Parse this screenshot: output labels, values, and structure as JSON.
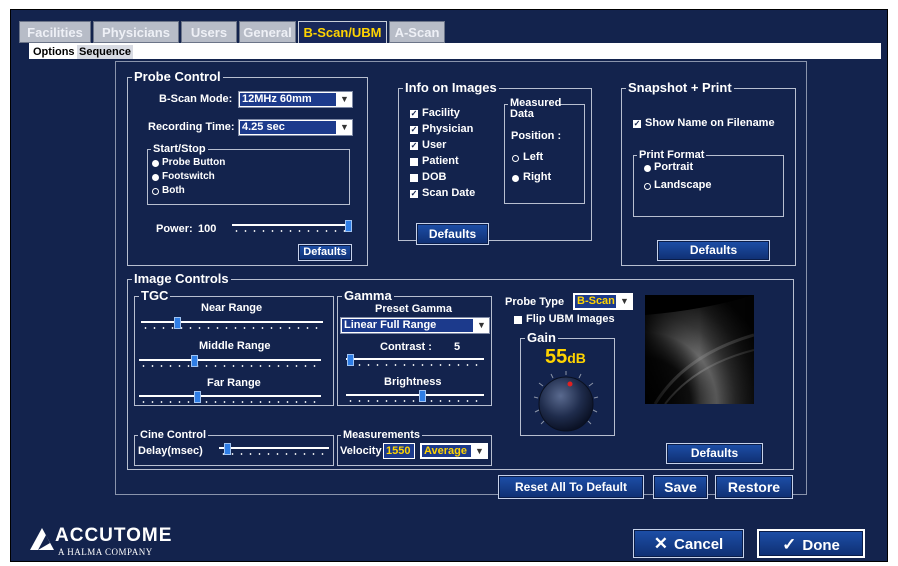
{
  "tabs": [
    {
      "label": "Facilities",
      "active": false
    },
    {
      "label": "Physicians",
      "active": false
    },
    {
      "label": "Users",
      "active": false
    },
    {
      "label": "General",
      "active": false
    },
    {
      "label": "B-Scan/UBM",
      "active": true
    },
    {
      "label": "A-Scan",
      "active": false
    }
  ],
  "subtabs": [
    {
      "label": "Options",
      "selected": true
    },
    {
      "label": "Sequence",
      "selected": false
    }
  ],
  "probe_control": {
    "title": "Probe Control",
    "bscan_mode_label": "B-Scan Mode:",
    "bscan_mode_value": "12MHz 60mm",
    "recording_time_label": "Recording Time:",
    "recording_time_value": "4.25 sec",
    "start_stop_title": "Start/Stop",
    "start_stop_options": [
      {
        "label": "Probe Button",
        "selected": true
      },
      {
        "label": "Footswitch",
        "selected": true
      },
      {
        "label": "Both",
        "selected": false
      }
    ],
    "power_label": "Power:",
    "power_value": "100",
    "power_level": 1.0,
    "defaults_label": "Defaults"
  },
  "info_on_images": {
    "title": "Info on Images",
    "items": [
      {
        "label": "Facility",
        "checked": true
      },
      {
        "label": "Physician",
        "checked": true
      },
      {
        "label": "User",
        "checked": true
      },
      {
        "label": "Patient",
        "checked": false
      },
      {
        "label": "DOB",
        "checked": false
      },
      {
        "label": "Scan Date",
        "checked": true
      }
    ],
    "measured_title": "Measured Data",
    "position_label": "Position :",
    "positions": [
      {
        "label": "Left",
        "selected": false
      },
      {
        "label": "Right",
        "selected": true
      }
    ],
    "defaults_label": "Defaults"
  },
  "snapshot": {
    "title": "Snapshot + Print",
    "show_name_label": "Show Name on Filename",
    "show_name_checked": true,
    "print_format_title": "Print Format",
    "formats": [
      {
        "label": "Portrait",
        "selected": true
      },
      {
        "label": "Landscape",
        "selected": false
      }
    ],
    "defaults_label": "Defaults"
  },
  "image_controls": {
    "title": "Image Controls",
    "tgc": {
      "title": "TGC",
      "near_label": "Near Range",
      "near_level": 0.2,
      "middle_label": "Middle Range",
      "middle_level": 0.3,
      "far_label": "Far Range",
      "far_level": 0.32
    },
    "gamma": {
      "title": "Gamma",
      "preset_label": "Preset Gamma",
      "preset_value": "Linear Full Range",
      "contrast_label": "Contrast :",
      "contrast_value": "5",
      "contrast_level": 0.03,
      "brightness_label": "Brightness",
      "brightness_level": 0.55
    },
    "probe_type_label": "Probe Type",
    "probe_type_value": "B-Scan",
    "flip_ubm_label": "Flip UBM Images",
    "flip_ubm_checked": false,
    "gain_title": "Gain",
    "gain_value": "55",
    "gain_unit": "dB",
    "cine": {
      "title": "Cine Control",
      "delay_label": "Delay(msec)",
      "delay_level": 0.07
    },
    "measurements": {
      "title": "Measurements",
      "velocity_label": "Velocity",
      "velocity_value": "1550",
      "mode_value": "Average"
    },
    "defaults_label": "Defaults"
  },
  "actions": {
    "reset_label": "Reset All To Default",
    "save_label": "Save",
    "restore_label": "Restore"
  },
  "footer": {
    "logo_text": "ACCUTOME",
    "logo_sub": "A HALMA COMPANY",
    "cancel_label": "Cancel",
    "done_label": "Done"
  },
  "colors": {
    "background": "#13234d",
    "accent_yellow": "#ffd400",
    "button_blue": "#1d4fa8",
    "thumb_blue": "#2f7ee6"
  }
}
